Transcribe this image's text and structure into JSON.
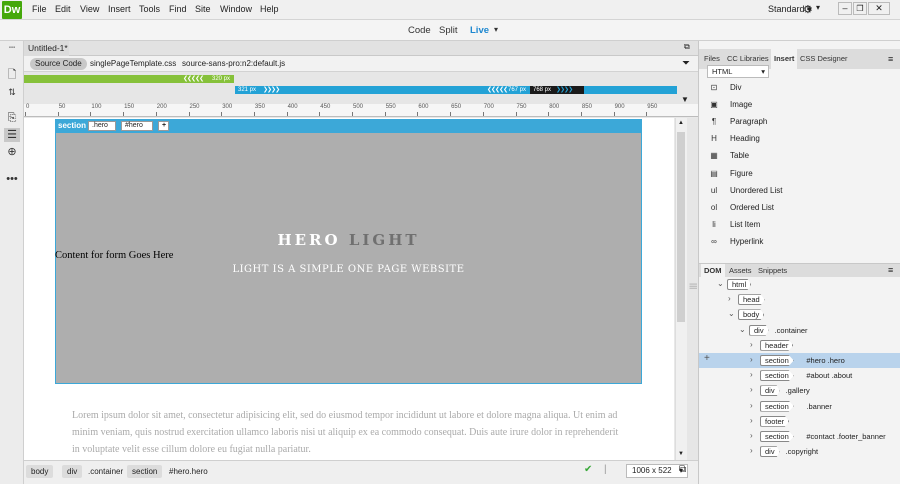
{
  "app": {
    "logo": "Dw"
  },
  "menu": [
    "File",
    "Edit",
    "View",
    "Insert",
    "Tools",
    "Find",
    "Site",
    "Window",
    "Help"
  ],
  "workspace": {
    "label": "Standard"
  },
  "modes": {
    "code": "Code",
    "split": "Split",
    "live": "Live"
  },
  "document": {
    "tab": "Untitled-1*",
    "source_code": "Source Code",
    "files": [
      "singlePageTemplate.css",
      "source-sans-pro:n2:default.js"
    ]
  },
  "media_queries": {
    "mq1": "320  px",
    "mq2_min": "321  px",
    "mq2_mid": "767  px",
    "mq2_max": "768  px"
  },
  "ruler": [
    "0",
    "50",
    "100",
    "150",
    "200",
    "250",
    "300",
    "350",
    "400",
    "450",
    "500",
    "550",
    "600",
    "650",
    "700",
    "750",
    "800",
    "850",
    "900",
    "950"
  ],
  "selection": {
    "tag": "section",
    "class": ".hero",
    "id": "#hero",
    "add": "+"
  },
  "hero": {
    "title_bright": "HERO",
    "title_dim": "LIGHT",
    "subtitle": "LIGHT IS A SIMPLE ONE PAGE WEBSITE"
  },
  "form_text": "Content for form Goes Here",
  "lorem": "Lorem ipsum dolor sit amet, consectetur adipisicing elit, sed do eiusmod tempor incididunt ut labore et dolore magna aliqua. Ut enim ad minim veniam, quis nostrud exercitation ullamco laboris nisi ut aliquip ex ea commodo consequat. Duis aute irure dolor in reprehenderit in voluptate velit esse cillum dolore eu fugiat nulla pariatur.",
  "status": {
    "crumbs": [
      "body",
      "div",
      ".container",
      "section",
      "#hero.hero"
    ],
    "size": "1006 x 522"
  },
  "panels": {
    "tabs": [
      "Files",
      "CC Libraries",
      "Insert",
      "CSS Designer"
    ],
    "insert_category": "HTML",
    "insert_items": [
      {
        "icon": "div-icon",
        "label": "Div",
        "glyph": "⊡"
      },
      {
        "icon": "image-icon",
        "label": "Image",
        "glyph": "▣"
      },
      {
        "icon": "paragraph-icon",
        "label": "Paragraph",
        "glyph": "¶"
      },
      {
        "icon": "heading-icon",
        "label": "Heading",
        "glyph": "H"
      },
      {
        "icon": "table-icon",
        "label": "Table",
        "glyph": "▦"
      },
      {
        "icon": "figure-icon",
        "label": "Figure",
        "glyph": "▤"
      },
      {
        "icon": "unordered-list-icon",
        "label": "Unordered List",
        "glyph": "ul"
      },
      {
        "icon": "ordered-list-icon",
        "label": "Ordered List",
        "glyph": "ol"
      },
      {
        "icon": "list-item-icon",
        "label": "List Item",
        "glyph": "li"
      },
      {
        "icon": "hyperlink-icon",
        "label": "Hyperlink",
        "glyph": "∞"
      }
    ],
    "dom_tabs": [
      "DOM",
      "Assets",
      "Snippets"
    ],
    "dom_tree": [
      {
        "tag": "html",
        "text": "",
        "depth": 0,
        "open": true
      },
      {
        "tag": "head",
        "text": "",
        "depth": 1,
        "open": false
      },
      {
        "tag": "body",
        "text": "",
        "depth": 1,
        "open": true
      },
      {
        "tag": "div",
        "text": ".container",
        "depth": 2,
        "open": true
      },
      {
        "tag": "header",
        "text": "",
        "depth": 3,
        "open": false
      },
      {
        "tag": "section",
        "text": "#hero .hero",
        "depth": 3,
        "open": false,
        "selected": true
      },
      {
        "tag": "section",
        "text": "#about .about",
        "depth": 3,
        "open": false
      },
      {
        "tag": "div",
        "text": ".gallery",
        "depth": 3,
        "open": false
      },
      {
        "tag": "section",
        "text": ".banner",
        "depth": 3,
        "open": false
      },
      {
        "tag": "footer",
        "text": "",
        "depth": 3,
        "open": false
      },
      {
        "tag": "section",
        "text": "#contact .footer_banner",
        "depth": 3,
        "open": false
      },
      {
        "tag": "div",
        "text": ".copyright",
        "depth": 3,
        "open": false
      }
    ]
  },
  "colors": {
    "accent": "#3ca8d8",
    "brand": "#45a80a",
    "mq_min": "#86c13a",
    "selected_row": "#b9d3ec"
  }
}
